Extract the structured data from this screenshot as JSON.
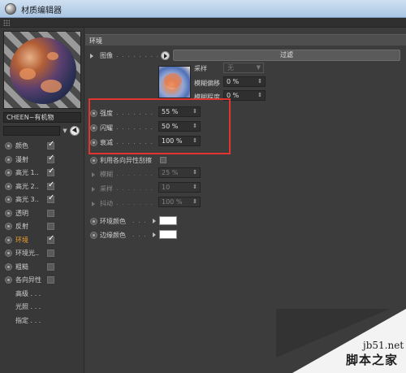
{
  "window": {
    "title": "材质编辑器"
  },
  "material": {
    "name": "CHEEN~有机物"
  },
  "channels": [
    {
      "label": "颜色",
      "checked": true,
      "active": false
    },
    {
      "label": "漫射",
      "checked": true,
      "active": false
    },
    {
      "label": "高光 1..",
      "checked": true,
      "active": false
    },
    {
      "label": "高光 2..",
      "checked": true,
      "active": false
    },
    {
      "label": "高光 3..",
      "checked": true,
      "active": false
    },
    {
      "label": "透明",
      "checked": false,
      "active": false
    },
    {
      "label": "反射",
      "checked": false,
      "active": false
    },
    {
      "label": "环境",
      "checked": true,
      "active": true
    },
    {
      "label": "环境光..",
      "checked": false,
      "active": false
    },
    {
      "label": "粗糙",
      "checked": false,
      "active": false
    },
    {
      "label": "各向异性",
      "checked": false,
      "active": false
    }
  ],
  "sub_items": [
    "高级 . . .",
    "光照 . . .",
    "指定 . . ."
  ],
  "environment": {
    "section_title": "环境",
    "image": {
      "label": "图像",
      "filter_button": "过滤"
    },
    "sampling": {
      "label": "采样",
      "value": "无"
    },
    "blur_offset": {
      "label": "模糊偏移",
      "value": "0 %"
    },
    "blur_scale": {
      "label": "模糊程度",
      "value": "0 %"
    },
    "strength": {
      "label": "强度",
      "value": "55 %"
    },
    "flicker": {
      "label": "闪耀",
      "value": "50 %"
    },
    "falloff": {
      "label": "衰减",
      "value": "100 %"
    },
    "anisotropic": {
      "label": "利用各向异性刮擦"
    },
    "blur": {
      "label": "模糊",
      "value": "25 %"
    },
    "sampling2": {
      "label": "采样",
      "value": "10"
    },
    "jitter": {
      "label": "抖动",
      "value": "100 %"
    },
    "env_color": {
      "label": "环境颜色",
      "color": "#ffffff"
    },
    "edge_color": {
      "label": "边缘颜色",
      "color": "#ffffff"
    }
  },
  "watermark": {
    "site": "jb51.net",
    "brand": "脚本之家"
  },
  "colors": {
    "highlight": "#e2342f",
    "active_channel": "#f0a030"
  }
}
